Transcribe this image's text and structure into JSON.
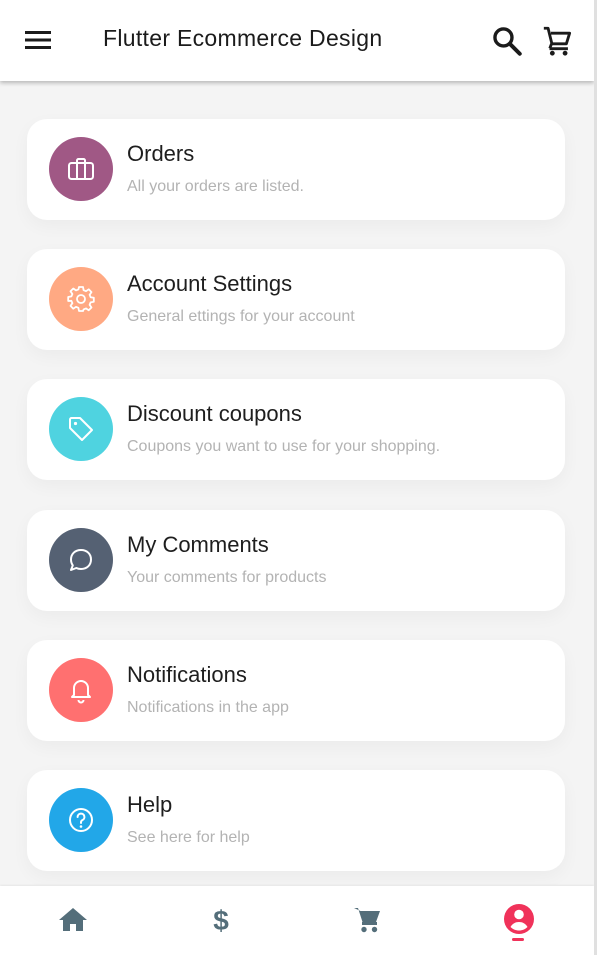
{
  "appbar": {
    "title": "Flutter Ecommerce Design",
    "icons": [
      "menu-icon",
      "search-icon",
      "cart-icon"
    ]
  },
  "menu": {
    "items": [
      {
        "title": "Orders",
        "subtitle": "All your orders are listed.",
        "icon": "briefcase-icon",
        "color": "#a05885"
      },
      {
        "title": "Account Settings",
        "subtitle": "General ettings for your account",
        "icon": "gear-icon",
        "color": "#ffa983"
      },
      {
        "title": "Discount coupons",
        "subtitle": "Coupons you want to use for your shopping.",
        "icon": "tag-icon",
        "color": "#4fd3e0"
      },
      {
        "title": "My Comments",
        "subtitle": "Your comments for products",
        "icon": "chat-bubble-icon",
        "color": "#556173"
      },
      {
        "title": "Notifications",
        "subtitle": "Notifications in the app",
        "icon": "bell-icon",
        "color": "#ff7070"
      },
      {
        "title": "Help",
        "subtitle": "See here for help",
        "icon": "help-circle-icon",
        "color": "#22a7e8"
      }
    ]
  },
  "bottom_nav": {
    "items": [
      {
        "name": "home",
        "icon": "home-icon",
        "active": false
      },
      {
        "name": "deals",
        "icon": "dollar-icon",
        "active": false
      },
      {
        "name": "cart",
        "icon": "cart-icon",
        "active": false
      },
      {
        "name": "profile",
        "icon": "account-circle-icon",
        "active": true
      }
    ],
    "inactive_color": "#546e7a",
    "active_color": "#f0325a"
  }
}
